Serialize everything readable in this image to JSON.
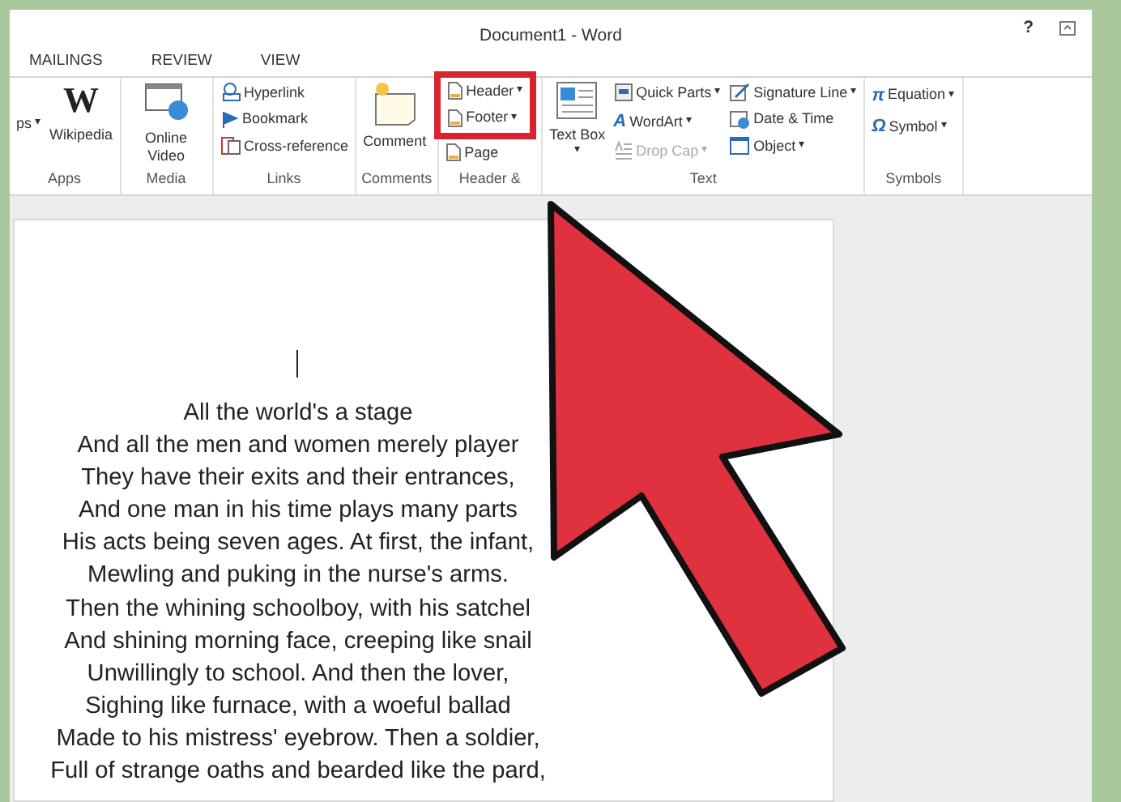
{
  "window": {
    "title": "Document1 - Word",
    "controls": [
      "?"
    ]
  },
  "tabs": [
    "MAILINGS",
    "REVIEW",
    "VIEW"
  ],
  "ribbon": [
    {
      "label": "Apps",
      "items": [
        {
          "kind": "cut",
          "label": "ps",
          "caret": "▾",
          "disabled": false,
          "highlighted": false
        },
        {
          "kind": "large",
          "glyph": "W",
          "label": "Wikipedia",
          "disabled": false,
          "highlighted": false
        }
      ]
    },
    {
      "label": "Media",
      "items": [
        {
          "kind": "large",
          "label": "Online Video",
          "disabled": false,
          "highlighted": false
        }
      ]
    },
    {
      "label": "Links",
      "items": [
        {
          "kind": "small",
          "label": "Hyperlink",
          "disabled": false,
          "highlighted": false
        },
        {
          "kind": "small",
          "label": "Bookmark",
          "disabled": false,
          "highlighted": false
        },
        {
          "kind": "small",
          "label": "Cross-reference",
          "disabled": false,
          "highlighted": false
        }
      ]
    },
    {
      "label": "Comments",
      "items": [
        {
          "kind": "large",
          "label": "Comment",
          "disabled": false,
          "highlighted": false
        }
      ]
    },
    {
      "label": "Header &",
      "items": [
        {
          "kind": "small",
          "label": "Header",
          "caret": "▾",
          "disabled": false,
          "highlighted": true
        },
        {
          "kind": "small",
          "label": "Footer",
          "caret": "▾",
          "disabled": false,
          "highlighted": true
        },
        {
          "kind": "small",
          "label": "Page",
          "disabled": false,
          "highlighted": false
        }
      ]
    },
    {
      "label": "Text",
      "items": [
        {
          "kind": "large",
          "label": "Text Box",
          "caret": "▾",
          "disabled": false,
          "highlighted": false
        },
        {
          "kind": "small",
          "label": "Quick Parts",
          "caret": "▾",
          "disabled": false,
          "highlighted": false
        },
        {
          "kind": "small",
          "glyph": "A",
          "label": "WordArt",
          "caret": "▾",
          "disabled": false,
          "highlighted": false
        },
        {
          "kind": "small",
          "label": "Drop Cap",
          "caret": "▾",
          "disabled": true,
          "highlighted": false
        },
        {
          "kind": "small",
          "label": "Signature Line",
          "caret": "▾",
          "disabled": false,
          "highlighted": false
        },
        {
          "kind": "small",
          "label": "Date & Time",
          "disabled": false,
          "highlighted": false
        },
        {
          "kind": "small",
          "label": "Object",
          "caret": "▾",
          "disabled": false,
          "highlighted": false
        }
      ]
    },
    {
      "label": "Symbols",
      "items": [
        {
          "kind": "small",
          "glyph": "π",
          "label": "Equation",
          "caret": "▾",
          "disabled": false,
          "highlighted": false
        },
        {
          "kind": "small",
          "glyph": "Ω",
          "label": "Symbol",
          "caret": "▾",
          "disabled": false,
          "highlighted": false
        }
      ]
    }
  ],
  "document": {
    "lines": [
      "All the world's a stage",
      "And all the men and women merely player",
      "They have their exits and their entrances,",
      "And one man in his time plays many parts",
      "His acts being seven ages. At first, the infant,",
      "Mewling and puking in the nurse's arms.",
      "Then the whining schoolboy, with his satchel",
      "And shining morning face, creeping like snail",
      "Unwillingly to school. And then the lover,",
      "Sighing like furnace, with a woeful ballad",
      "Made to his mistress' eyebrow. Then a soldier,",
      "Full of strange oaths and bearded like the pard,"
    ]
  }
}
